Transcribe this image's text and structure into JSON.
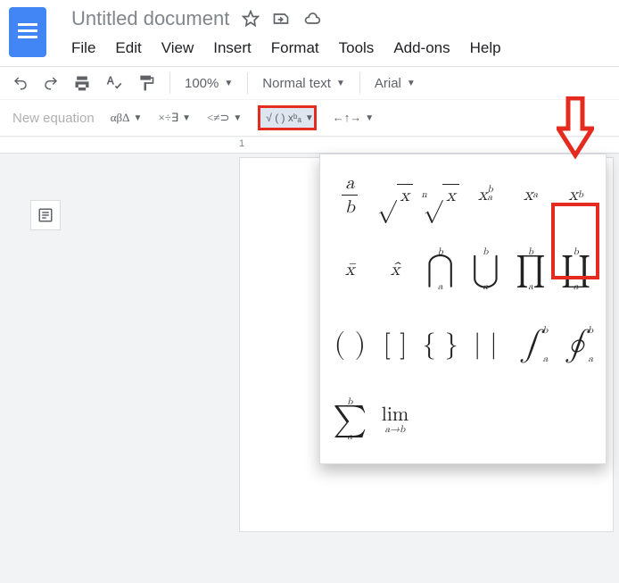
{
  "header": {
    "title": "Untitled document",
    "menus": [
      "File",
      "Edit",
      "View",
      "Insert",
      "Format",
      "Tools",
      "Add-ons",
      "Help"
    ]
  },
  "toolbar": {
    "zoom": "100%",
    "style": "Normal text",
    "font": "Arial"
  },
  "equation_toolbar": {
    "label": "New equation",
    "greek": "αβΔ",
    "ops": "×÷∃",
    "rel": "<≠⊃",
    "math": "√ ( ) xᵇₐ",
    "arrows": "←↑→"
  },
  "ruler": {
    "mark1": "1"
  },
  "eq_panel": {
    "frac_a": "a",
    "frac_b": "b",
    "sqrt": "√",
    "x": "x",
    "nroot_n": "n",
    "xab_a": "a",
    "xab_b": "b",
    "xa_a": "a",
    "xb_b": "b",
    "xbar": "x̄",
    "xhat": "x̂",
    "bigcap": "⋂",
    "bigcup": "⋃",
    "prod": "∏",
    "coprod": "∐",
    "paren": "( )",
    "brack": "[ ]",
    "brace": "{ }",
    "bars": "| |",
    "int": "∫",
    "oint": "∮",
    "sum": "∑",
    "lim": "lim",
    "lim_sub": "a→b",
    "bound_a": "a",
    "bound_b": "b"
  }
}
